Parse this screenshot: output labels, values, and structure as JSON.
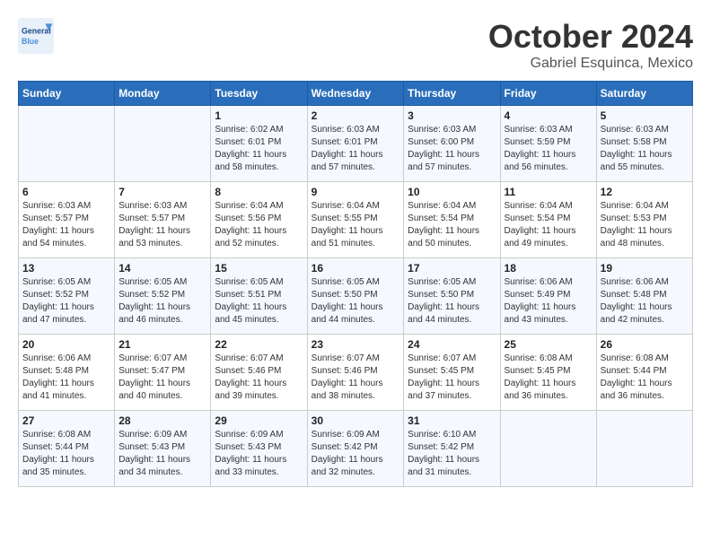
{
  "header": {
    "logo_general": "General",
    "logo_blue": "Blue",
    "month_title": "October 2024",
    "location": "Gabriel Esquinca, Mexico"
  },
  "calendar": {
    "days_of_week": [
      "Sunday",
      "Monday",
      "Tuesday",
      "Wednesday",
      "Thursday",
      "Friday",
      "Saturday"
    ],
    "weeks": [
      [
        {
          "day": "",
          "info": ""
        },
        {
          "day": "",
          "info": ""
        },
        {
          "day": "1",
          "info": "Sunrise: 6:02 AM\nSunset: 6:01 PM\nDaylight: 11 hours and 58 minutes."
        },
        {
          "day": "2",
          "info": "Sunrise: 6:03 AM\nSunset: 6:01 PM\nDaylight: 11 hours and 57 minutes."
        },
        {
          "day": "3",
          "info": "Sunrise: 6:03 AM\nSunset: 6:00 PM\nDaylight: 11 hours and 57 minutes."
        },
        {
          "day": "4",
          "info": "Sunrise: 6:03 AM\nSunset: 5:59 PM\nDaylight: 11 hours and 56 minutes."
        },
        {
          "day": "5",
          "info": "Sunrise: 6:03 AM\nSunset: 5:58 PM\nDaylight: 11 hours and 55 minutes."
        }
      ],
      [
        {
          "day": "6",
          "info": "Sunrise: 6:03 AM\nSunset: 5:57 PM\nDaylight: 11 hours and 54 minutes."
        },
        {
          "day": "7",
          "info": "Sunrise: 6:03 AM\nSunset: 5:57 PM\nDaylight: 11 hours and 53 minutes."
        },
        {
          "day": "8",
          "info": "Sunrise: 6:04 AM\nSunset: 5:56 PM\nDaylight: 11 hours and 52 minutes."
        },
        {
          "day": "9",
          "info": "Sunrise: 6:04 AM\nSunset: 5:55 PM\nDaylight: 11 hours and 51 minutes."
        },
        {
          "day": "10",
          "info": "Sunrise: 6:04 AM\nSunset: 5:54 PM\nDaylight: 11 hours and 50 minutes."
        },
        {
          "day": "11",
          "info": "Sunrise: 6:04 AM\nSunset: 5:54 PM\nDaylight: 11 hours and 49 minutes."
        },
        {
          "day": "12",
          "info": "Sunrise: 6:04 AM\nSunset: 5:53 PM\nDaylight: 11 hours and 48 minutes."
        }
      ],
      [
        {
          "day": "13",
          "info": "Sunrise: 6:05 AM\nSunset: 5:52 PM\nDaylight: 11 hours and 47 minutes."
        },
        {
          "day": "14",
          "info": "Sunrise: 6:05 AM\nSunset: 5:52 PM\nDaylight: 11 hours and 46 minutes."
        },
        {
          "day": "15",
          "info": "Sunrise: 6:05 AM\nSunset: 5:51 PM\nDaylight: 11 hours and 45 minutes."
        },
        {
          "day": "16",
          "info": "Sunrise: 6:05 AM\nSunset: 5:50 PM\nDaylight: 11 hours and 44 minutes."
        },
        {
          "day": "17",
          "info": "Sunrise: 6:05 AM\nSunset: 5:50 PM\nDaylight: 11 hours and 44 minutes."
        },
        {
          "day": "18",
          "info": "Sunrise: 6:06 AM\nSunset: 5:49 PM\nDaylight: 11 hours and 43 minutes."
        },
        {
          "day": "19",
          "info": "Sunrise: 6:06 AM\nSunset: 5:48 PM\nDaylight: 11 hours and 42 minutes."
        }
      ],
      [
        {
          "day": "20",
          "info": "Sunrise: 6:06 AM\nSunset: 5:48 PM\nDaylight: 11 hours and 41 minutes."
        },
        {
          "day": "21",
          "info": "Sunrise: 6:07 AM\nSunset: 5:47 PM\nDaylight: 11 hours and 40 minutes."
        },
        {
          "day": "22",
          "info": "Sunrise: 6:07 AM\nSunset: 5:46 PM\nDaylight: 11 hours and 39 minutes."
        },
        {
          "day": "23",
          "info": "Sunrise: 6:07 AM\nSunset: 5:46 PM\nDaylight: 11 hours and 38 minutes."
        },
        {
          "day": "24",
          "info": "Sunrise: 6:07 AM\nSunset: 5:45 PM\nDaylight: 11 hours and 37 minutes."
        },
        {
          "day": "25",
          "info": "Sunrise: 6:08 AM\nSunset: 5:45 PM\nDaylight: 11 hours and 36 minutes."
        },
        {
          "day": "26",
          "info": "Sunrise: 6:08 AM\nSunset: 5:44 PM\nDaylight: 11 hours and 36 minutes."
        }
      ],
      [
        {
          "day": "27",
          "info": "Sunrise: 6:08 AM\nSunset: 5:44 PM\nDaylight: 11 hours and 35 minutes."
        },
        {
          "day": "28",
          "info": "Sunrise: 6:09 AM\nSunset: 5:43 PM\nDaylight: 11 hours and 34 minutes."
        },
        {
          "day": "29",
          "info": "Sunrise: 6:09 AM\nSunset: 5:43 PM\nDaylight: 11 hours and 33 minutes."
        },
        {
          "day": "30",
          "info": "Sunrise: 6:09 AM\nSunset: 5:42 PM\nDaylight: 11 hours and 32 minutes."
        },
        {
          "day": "31",
          "info": "Sunrise: 6:10 AM\nSunset: 5:42 PM\nDaylight: 11 hours and 31 minutes."
        },
        {
          "day": "",
          "info": ""
        },
        {
          "day": "",
          "info": ""
        }
      ]
    ]
  }
}
